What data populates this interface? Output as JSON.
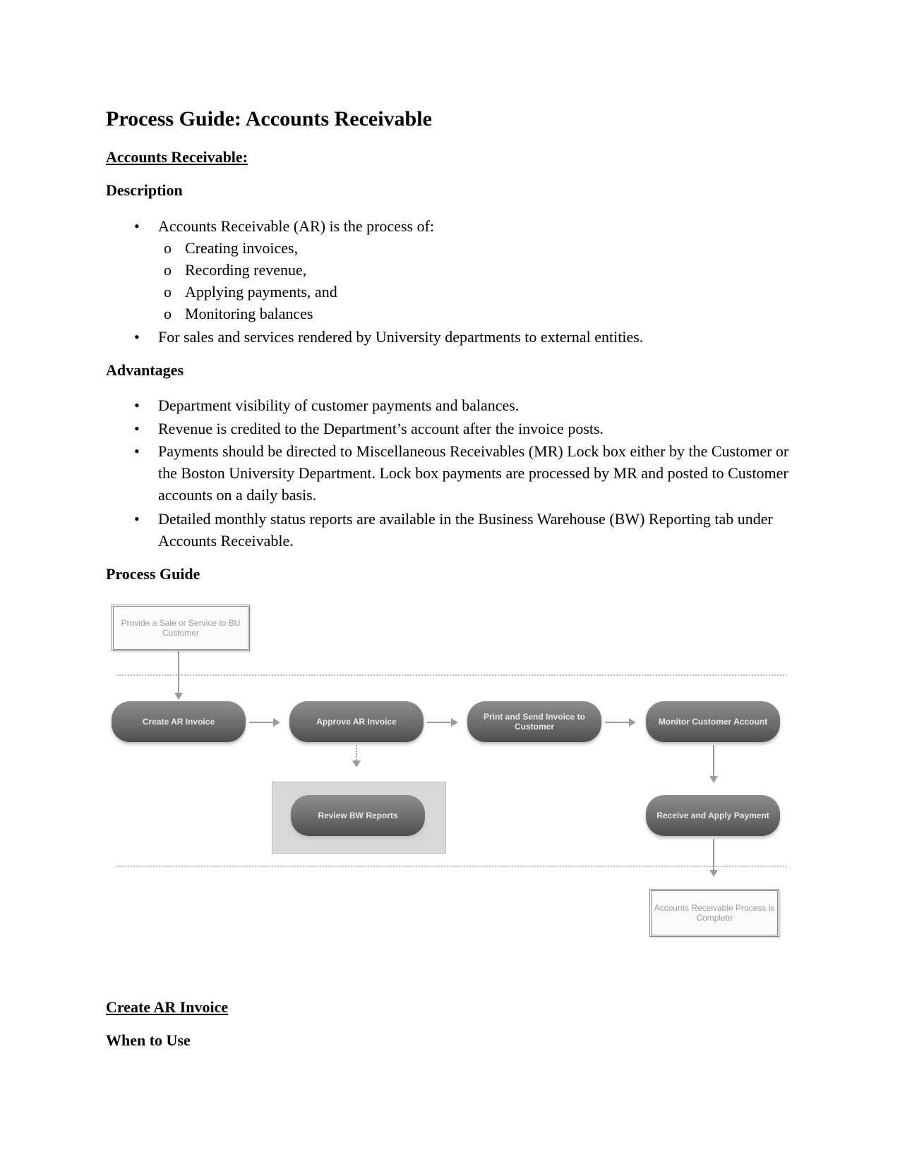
{
  "document": {
    "title": "Process Guide: Accounts Receivable",
    "section_heading": "Accounts Receivable:",
    "description": {
      "heading": "Description",
      "bullets": [
        "Accounts Receivable (AR) is the process of:",
        "For sales and services rendered by University departments to external entities."
      ],
      "sub_bullets": [
        "Creating invoices,",
        "Recording revenue,",
        "Applying payments, and",
        "Monitoring balances"
      ],
      "bullet_glyph": "•",
      "sub_bullet_glyph": "o"
    },
    "advantages": {
      "heading": "Advantages",
      "bullets": [
        "Department visibility of customer payments and balances.",
        "Revenue is credited to the Department’s account after the invoice posts.",
        "Payments should be directed to Miscellaneous Receivables (MR) Lock box either by the Customer or the Boston University Department. Lock box payments are processed by MR and posted to Customer accounts on a daily basis.",
        "Detailed monthly status reports are available in the Business Warehouse (BW) Reporting tab under Accounts Receivable."
      ]
    },
    "process_guide_heading": "Process Guide",
    "flowchart": {
      "start": "Provide a Sale or Service to BU Customer",
      "steps": [
        "Create AR Invoice",
        "Approve AR Invoice",
        "Print and Send Invoice to Customer",
        "Monitor Customer Account"
      ],
      "review": "Review BW Reports",
      "receive": "Receive and Apply Payment",
      "end": "Accounts Receivable Process is Complete"
    },
    "next_section_heading": "Create AR Invoice",
    "when_to_use_heading": "When to Use"
  }
}
